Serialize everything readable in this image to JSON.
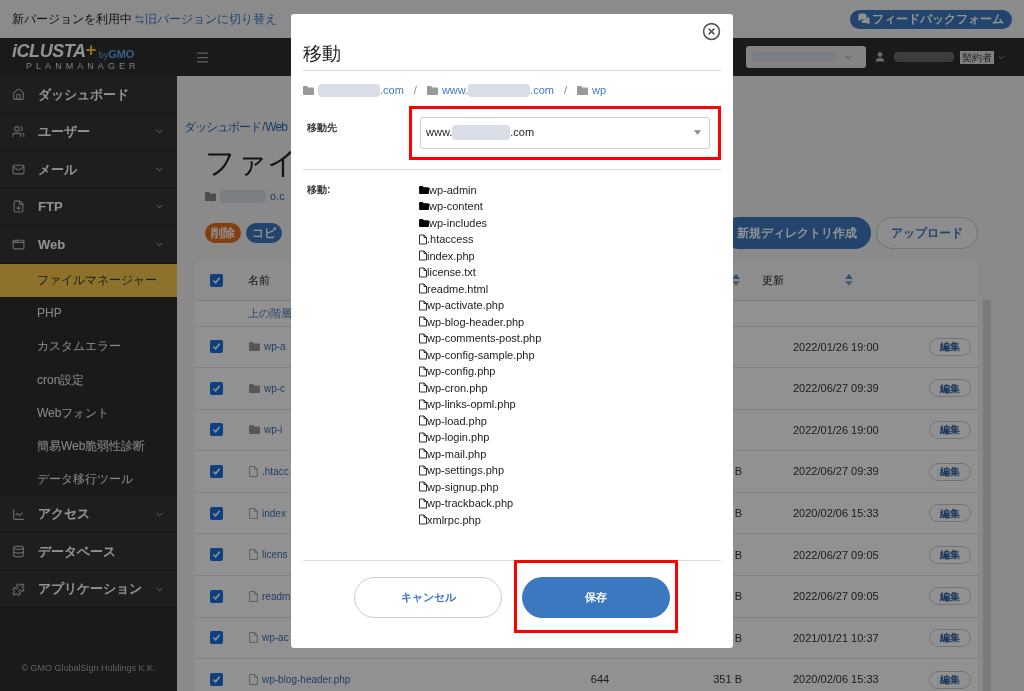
{
  "top_bar": {
    "status": "新バージョンを利用中",
    "switch_link": "旧バージョンに切り替え",
    "feedback_button": "フィードバックフォーム"
  },
  "logo": {
    "name": "iCLUSTA",
    "plus": "+",
    "by": "by",
    "brand": "GMO",
    "sub": "PLANMANAGER"
  },
  "sidebar": {
    "items": [
      {
        "label": "ダッシュボード",
        "expandable": false
      },
      {
        "label": "ユーザー",
        "expandable": true
      },
      {
        "label": "メール",
        "expandable": true
      },
      {
        "label": "FTP",
        "expandable": true
      },
      {
        "label": "Web",
        "expandable": true,
        "children": [
          {
            "label": "ファイルマネージャー",
            "selected": true
          },
          {
            "label": "PHP",
            "selected": false
          },
          {
            "label": "カスタムエラー",
            "selected": false
          },
          {
            "label": "cron設定",
            "selected": false
          },
          {
            "label": "Webフォント",
            "selected": false
          },
          {
            "label": "簡易Web脆弱性診断",
            "selected": false
          },
          {
            "label": "データ移行ツール",
            "selected": false
          }
        ]
      },
      {
        "label": "アクセス",
        "expandable": true
      },
      {
        "label": "データベース",
        "expandable": false
      },
      {
        "label": "アプリケーション",
        "expandable": true
      }
    ],
    "copyright": "© GMO GlobalSign Holdings K.K."
  },
  "header": {
    "account_badge": "契約者"
  },
  "breadcrumb": [
    "ダッシュボード",
    "Web"
  ],
  "breadcrumb_separator": "/",
  "page_title": "ファイ",
  "path": {
    "tail": "o.c"
  },
  "actions": {
    "left": [
      {
        "label": "削除",
        "kind": "danger"
      },
      {
        "label": "コピ",
        "kind": "primary"
      }
    ],
    "right": [
      {
        "label": "新規ディレクトリ作成",
        "kind": "primary"
      },
      {
        "label": "アップロード",
        "kind": "secondary"
      }
    ]
  },
  "table": {
    "columns": [
      "名前",
      "更新"
    ],
    "all_checked": true,
    "parent_row": "上の階層",
    "rows": [
      {
        "name": "wp-a",
        "kind": "folder",
        "checked": true,
        "updated": "2022/01/26 19:00",
        "edit": "編集"
      },
      {
        "name": "wp-c",
        "kind": "folder",
        "checked": true,
        "updated": "2022/06/27 09:39",
        "edit": "編集"
      },
      {
        "name": "wp-i",
        "kind": "folder",
        "checked": true,
        "updated": "2022/01/26 19:00",
        "edit": "編集"
      },
      {
        "name": ".htacc",
        "kind": "file",
        "checked": true,
        "size": "B",
        "updated": "2022/06/27 09:39",
        "edit": "編集"
      },
      {
        "name": "index",
        "kind": "file",
        "checked": true,
        "size": "B",
        "updated": "2020/02/06 15:33",
        "edit": "編集"
      },
      {
        "name": "licens",
        "kind": "file",
        "checked": true,
        "size": "B",
        "updated": "2022/06/27 09:05",
        "edit": "編集"
      },
      {
        "name": "readm",
        "kind": "file",
        "checked": true,
        "size": "B",
        "updated": "2022/06/27 09:05",
        "edit": "編集"
      },
      {
        "name": "wp-ac",
        "kind": "file",
        "checked": true,
        "size": "B",
        "updated": "2021/01/21 10:37",
        "edit": "編集"
      },
      {
        "name": "wp-blog-header.php",
        "kind": "file",
        "checked": true,
        "column_3": "644",
        "size": "351 B",
        "updated": "2020/02/06 15:33",
        "edit": "編集"
      }
    ]
  },
  "dialog": {
    "title": "移動",
    "separator": "/",
    "crumbs": [
      {
        "tail": ".com",
        "redacted": true
      },
      {
        "lead": "www.",
        "tail": ".com",
        "redacted": true
      },
      {
        "lead": "wp",
        "redacted": false
      }
    ],
    "destination": {
      "label": "移動先",
      "lead": "www.",
      "tail": ".com",
      "highlighted": true
    },
    "move_label": "移動:",
    "items": [
      {
        "name": "wp-admin",
        "kind": "folder"
      },
      {
        "name": "wp-content",
        "kind": "folder"
      },
      {
        "name": "wp-includes",
        "kind": "folder"
      },
      {
        "name": ".htaccess",
        "kind": "file"
      },
      {
        "name": "index.php",
        "kind": "file"
      },
      {
        "name": "license.txt",
        "kind": "file"
      },
      {
        "name": "readme.html",
        "kind": "file"
      },
      {
        "name": "wp-activate.php",
        "kind": "file"
      },
      {
        "name": "wp-blog-header.php",
        "kind": "file"
      },
      {
        "name": "wp-comments-post.php",
        "kind": "file"
      },
      {
        "name": "wp-config-sample.php",
        "kind": "file"
      },
      {
        "name": "wp-config.php",
        "kind": "file"
      },
      {
        "name": "wp-cron.php",
        "kind": "file"
      },
      {
        "name": "wp-links-opml.php",
        "kind": "file"
      },
      {
        "name": "wp-load.php",
        "kind": "file"
      },
      {
        "name": "wp-login.php",
        "kind": "file"
      },
      {
        "name": "wp-mail.php",
        "kind": "file"
      },
      {
        "name": "wp-settings.php",
        "kind": "file"
      },
      {
        "name": "wp-signup.php",
        "kind": "file"
      },
      {
        "name": "wp-trackback.php",
        "kind": "file"
      },
      {
        "name": "xmlrpc.php",
        "kind": "file"
      }
    ],
    "buttons": [
      {
        "label": "キャンセル",
        "kind": "secondary",
        "highlighted": false
      },
      {
        "label": "保存",
        "kind": "primary",
        "highlighted": true
      }
    ]
  }
}
